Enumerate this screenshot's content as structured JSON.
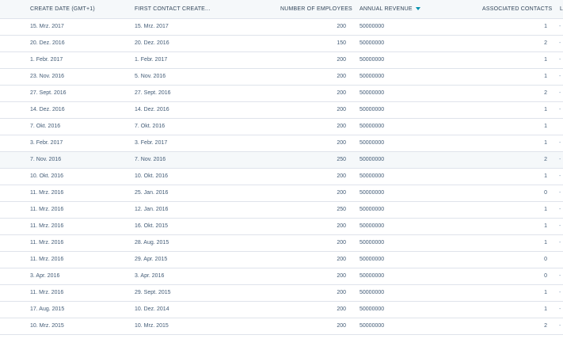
{
  "columns": {
    "create_date": "CREATE DATE (GMT+1)",
    "first_contact": "FIRST CONTACT CREATE...",
    "employees": "NUMBER OF EMPLOYEES",
    "revenue": "ANNUAL REVENUE",
    "contacts": "ASSOCIATED CONTACTS",
    "extra": "L"
  },
  "sort": {
    "column": "revenue",
    "direction": "descending",
    "icon": "sort-down-icon",
    "color": "#0091ae"
  },
  "rows": [
    {
      "create_date": "15. Mrz. 2017",
      "first_contact": "15. Mrz. 2017",
      "employees": "200",
      "revenue": "50000000",
      "contacts": "1",
      "extra": "-"
    },
    {
      "create_date": "20. Dez. 2016",
      "first_contact": "20. Dez. 2016",
      "employees": "150",
      "revenue": "50000000",
      "contacts": "2",
      "extra": "-"
    },
    {
      "create_date": "1. Febr. 2017",
      "first_contact": "1. Febr. 2017",
      "employees": "200",
      "revenue": "50000000",
      "contacts": "1",
      "extra": "-"
    },
    {
      "create_date": "23. Nov. 2016",
      "first_contact": "5. Nov. 2016",
      "employees": "200",
      "revenue": "50000000",
      "contacts": "1",
      "extra": "-"
    },
    {
      "create_date": "27. Sept. 2016",
      "first_contact": "27. Sept. 2016",
      "employees": "200",
      "revenue": "50000000",
      "contacts": "2",
      "extra": "-"
    },
    {
      "create_date": "14. Dez. 2016",
      "first_contact": "14. Dez. 2016",
      "employees": "200",
      "revenue": "50000000",
      "contacts": "1",
      "extra": "-"
    },
    {
      "create_date": "7. Okt. 2016",
      "first_contact": "7. Okt. 2016",
      "employees": "200",
      "revenue": "50000000",
      "contacts": "1",
      "extra": ""
    },
    {
      "create_date": "3. Febr. 2017",
      "first_contact": "3. Febr. 2017",
      "employees": "200",
      "revenue": "50000000",
      "contacts": "1",
      "extra": "-"
    },
    {
      "create_date": "7. Nov. 2016",
      "first_contact": "7. Nov. 2016",
      "employees": "250",
      "revenue": "50000000",
      "contacts": "2",
      "extra": "-"
    },
    {
      "create_date": "10. Okt. 2016",
      "first_contact": "10. Okt. 2016",
      "employees": "200",
      "revenue": "50000000",
      "contacts": "1",
      "extra": "-"
    },
    {
      "create_date": "11. Mrz. 2016",
      "first_contact": "25. Jan. 2016",
      "employees": "200",
      "revenue": "50000000",
      "contacts": "0",
      "extra": "-"
    },
    {
      "create_date": "11. Mrz. 2016",
      "first_contact": "12. Jan. 2016",
      "employees": "250",
      "revenue": "50000000",
      "contacts": "1",
      "extra": "-"
    },
    {
      "create_date": "11. Mrz. 2016",
      "first_contact": "16. Okt. 2015",
      "employees": "200",
      "revenue": "50000000",
      "contacts": "1",
      "extra": "-"
    },
    {
      "create_date": "11. Mrz. 2016",
      "first_contact": "28. Aug. 2015",
      "employees": "200",
      "revenue": "50000000",
      "contacts": "1",
      "extra": "-"
    },
    {
      "create_date": "11. Mrz. 2016",
      "first_contact": "29. Apr. 2015",
      "employees": "200",
      "revenue": "50000000",
      "contacts": "0",
      "extra": ""
    },
    {
      "create_date": "3. Apr. 2016",
      "first_contact": "3. Apr. 2016",
      "employees": "200",
      "revenue": "50000000",
      "contacts": "0",
      "extra": "-"
    },
    {
      "create_date": "11. Mrz. 2016",
      "first_contact": "29. Sept. 2015",
      "employees": "200",
      "revenue": "50000000",
      "contacts": "1",
      "extra": "-"
    },
    {
      "create_date": "17. Aug. 2015",
      "first_contact": "10. Dez. 2014",
      "employees": "200",
      "revenue": "50000000",
      "contacts": "1",
      "extra": "-"
    },
    {
      "create_date": "10. Mrz. 2015",
      "first_contact": "10. Mrz. 2015",
      "employees": "200",
      "revenue": "50000000",
      "contacts": "2",
      "extra": "-"
    }
  ],
  "highlighted_row": 8
}
